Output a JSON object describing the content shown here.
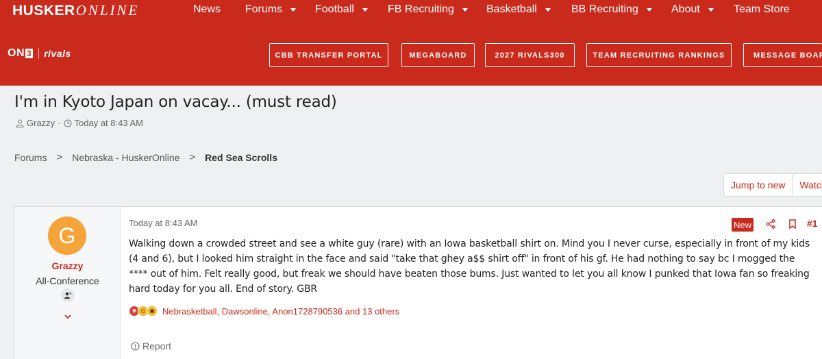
{
  "site": {
    "logo_bold": "HUSKER",
    "logo_script": "ONLINE",
    "brand_color": "#c92a1c"
  },
  "topnav": {
    "items": [
      {
        "label": "News",
        "has_caret": false
      },
      {
        "label": "Forums",
        "has_caret": true
      },
      {
        "label": "Football",
        "has_caret": true
      },
      {
        "label": "FB Recruiting",
        "has_caret": true
      },
      {
        "label": "Basketball",
        "has_caret": true
      },
      {
        "label": "BB Recruiting",
        "has_caret": true
      },
      {
        "label": "About",
        "has_caret": true
      },
      {
        "label": "Team Store",
        "has_caret": false
      }
    ]
  },
  "subbar": {
    "on3_text": "ON",
    "on3_box": "3",
    "rivals": "rivals",
    "pills": [
      "CBB TRANSFER PORTAL",
      "MEGABOARD",
      "2027 RIVALS300",
      "TEAM RECRUITING RANKINGS",
      "MESSAGE BOARD"
    ]
  },
  "thread": {
    "title": "I'm in Kyoto Japan on vacay... (must read)",
    "author": "Grazzy",
    "time": "Today at 8:43 AM",
    "breadcrumbs": [
      "Forums",
      "Nebraska - HuskerOnline",
      "Red Sea Scrolls"
    ]
  },
  "actions": {
    "jump": "Jump to new",
    "watch": "Watch"
  },
  "post": {
    "avatar_letter": "G",
    "avatar_color": "#f5a43a",
    "username": "Grazzy",
    "user_title": "All-Conference",
    "date": "Today at 8:43 AM",
    "new_badge": "New",
    "number": "#1",
    "body": "Walking down a crowded street and see a white guy (rare) with an Iowa basketball shirt on. Mind you I never curse, especially in front of my kids (4 and 6), but I looked him straight in the face and said \"take that ghey a$$ shirt off\" in front of his gf. He had nothing to say bc I mogged the **** out of him. Felt really good, but freak we should have beaten those bums. Just wanted to let you all know I punked that Iowa fan so freaking hard today for you all. End of story. GBR",
    "reactions": "Nebrasketball, Dawsonline, Anon1728790536 and 13 others",
    "report": "Report"
  }
}
